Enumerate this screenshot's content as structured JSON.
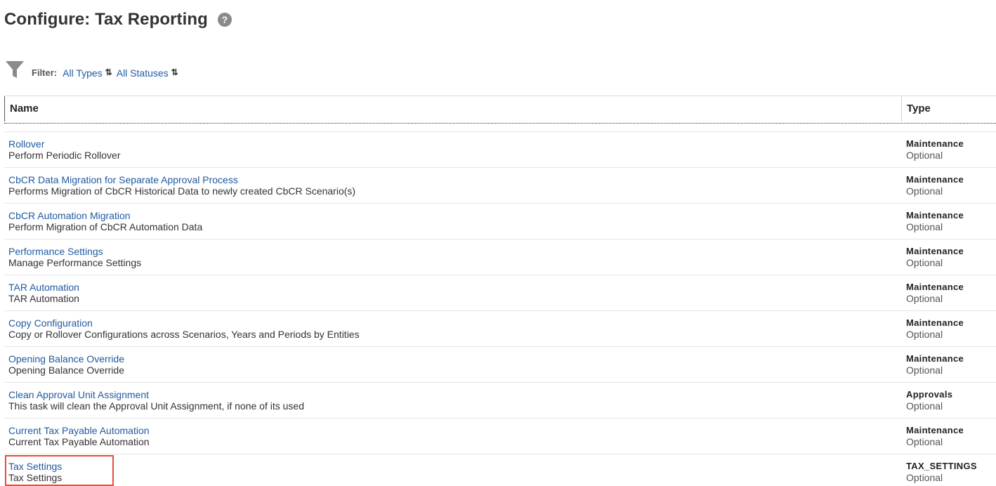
{
  "header": {
    "title": "Configure: Tax Reporting",
    "help_glyph": "?"
  },
  "filter": {
    "label": "Filter:",
    "type_value": "All Types",
    "status_value": "All Statuses",
    "swap_glyph": "⇅"
  },
  "table": {
    "columns": {
      "name": "Name",
      "type": "Type"
    },
    "rows": [
      {
        "name": "Rollover",
        "description": "Perform Periodic Rollover",
        "type": "Maintenance",
        "status": "Optional"
      },
      {
        "name": "CbCR Data Migration for Separate Approval Process",
        "description": "Performs Migration of CbCR Historical Data to newly created CbCR Scenario(s)",
        "type": "Maintenance",
        "status": "Optional"
      },
      {
        "name": "CbCR Automation Migration",
        "description": "Perform Migration of CbCR Automation Data",
        "type": "Maintenance",
        "status": "Optional"
      },
      {
        "name": "Performance Settings",
        "description": "Manage Performance Settings",
        "type": "Maintenance",
        "status": "Optional"
      },
      {
        "name": "TAR Automation",
        "description": "TAR Automation",
        "type": "Maintenance",
        "status": "Optional"
      },
      {
        "name": "Copy Configuration",
        "description": "Copy or Rollover Configurations across Scenarios, Years and Periods by Entities",
        "type": "Maintenance",
        "status": "Optional"
      },
      {
        "name": "Opening Balance Override",
        "description": "Opening Balance Override",
        "type": "Maintenance",
        "status": "Optional"
      },
      {
        "name": "Clean Approval Unit Assignment",
        "description": "This task will clean the Approval Unit Assignment, if none of its used",
        "type": "Approvals",
        "status": "Optional"
      },
      {
        "name": "Current Tax Payable Automation",
        "description": "Current Tax Payable Automation",
        "type": "Maintenance",
        "status": "Optional"
      },
      {
        "name": "Tax Settings",
        "description": "Tax Settings",
        "type": "TAX_SETTINGS",
        "status": "Optional"
      }
    ]
  },
  "colors": {
    "link": "#1f5aa0",
    "highlight": "#e74c3c"
  }
}
